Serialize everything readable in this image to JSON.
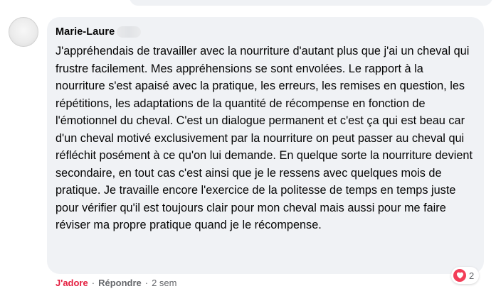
{
  "comment": {
    "author": "Marie-Laure",
    "text": "J'appréhendais de travailler avec la nourriture d'autant plus que j'ai un cheval qui frustre facilement. Mes appréhensions se sont envolées. Le rapport à la nourriture s'est apaisé avec la pratique, les erreurs, les remises en question, les répétitions, les adaptations de la quantité de récompense en fonction de l'émotionnel du cheval. C'est un dialogue permanent et c'est ça qui est beau car d'un cheval motivé exclusivement par la nourriture on peut passer au cheval qui réfléchit posément à ce qu'on lui demande. En quelque sorte la nourriture devient secondaire, en tout cas c'est ainsi que je le ressens avec quelques mois de pratique. Je travaille encore l'exercice de la politesse de temps en temps juste pour vérifier qu'il est toujours clair pour mon cheval mais aussi pour me faire réviser ma propre pratique quand je le récompense.",
    "reaction_icon": "heart-icon",
    "reaction_count": "2",
    "like_label": "J'adore",
    "reply_label": "Répondre",
    "separator": "·",
    "timestamp": "2 sem"
  },
  "colors": {
    "bubble": "#f0f2f5",
    "text": "#050505",
    "muted": "#65676b",
    "love_red": "#e41e3f",
    "heart": "#f33e58"
  }
}
